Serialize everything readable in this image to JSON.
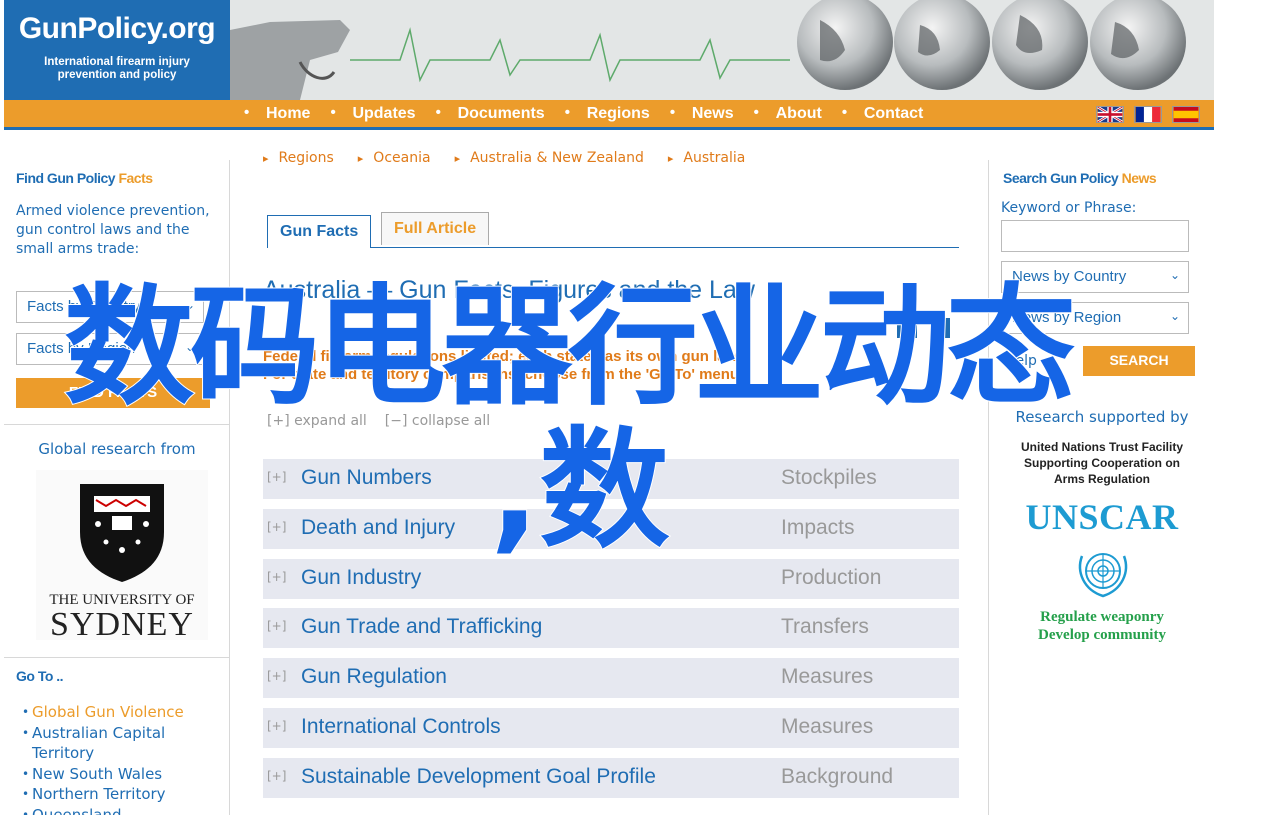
{
  "header": {
    "logo_title": "GunPolicy.org",
    "logo_subtitle_1": "International firearm injury",
    "logo_subtitle_2": "prevention and policy"
  },
  "nav": {
    "items": [
      "Home",
      "Updates",
      "Documents",
      "Regions",
      "News",
      "About",
      "Contact"
    ],
    "flags": [
      "uk-flag-icon",
      "france-flag-icon",
      "spain-flag-icon"
    ]
  },
  "left": {
    "find_title_main": "Find Gun Policy ",
    "find_title_accent": "Facts",
    "find_desc": "Armed violence prevention, gun control laws and the small arms trade:",
    "select1": "Facts by Country",
    "select2": "Facts by Region",
    "find_button": "FIND FACTS",
    "uni_text": "Global research from",
    "uni_name_1": "THE UNIVERSITY OF",
    "uni_name_2": "SYDNEY",
    "goto_title": "Go To ..",
    "goto_items": [
      "Global Gun Violence",
      "Australian Capital Territory",
      "New South Wales",
      "Northern Territory",
      "Queensland"
    ]
  },
  "main": {
    "breadcrumbs": [
      "Regions",
      "Oceania",
      "Australia & New Zealand",
      "Australia"
    ],
    "tab_active": "Gun Facts",
    "tab_other": "Full Article",
    "title": "Australia — Gun Facts, Figures and the Law",
    "intro_1": "Federal firearm regulations limited; each state has its own gun law.",
    "intro_2": "For state and territory comparisons, choose from the 'Go To' menu.",
    "expand_all": "expand all",
    "collapse_all": "collapse all",
    "rows": [
      {
        "label": "Gun Numbers",
        "category": "Stockpiles"
      },
      {
        "label": "Death and Injury",
        "category": "Impacts"
      },
      {
        "label": "Gun Industry",
        "category": "Production"
      },
      {
        "label": "Gun Trade and Trafficking",
        "category": "Transfers"
      },
      {
        "label": "Gun Regulation",
        "category": "Measures"
      },
      {
        "label": "International Controls",
        "category": "Measures"
      },
      {
        "label": "Sustainable Development Goal Profile",
        "category": "Background"
      }
    ]
  },
  "right": {
    "search_title_main": "Search Gun Policy ",
    "search_title_accent": "News",
    "keyword_label": "Keyword or Phrase:",
    "select1": "News by Country",
    "select2": "News by Region",
    "help": "Help",
    "search_button": "SEARCH",
    "research_text": "Research supported by",
    "untf_1": "United Nations Trust Facility",
    "untf_2": "Supporting Cooperation on",
    "untf_3": "Arms Regulation",
    "unscar": "UNSCAR",
    "unscar_tag_1": "Regulate weaponry",
    "unscar_tag_2": "Develop community"
  },
  "overlay": {
    "line1": "数码电器行业动态",
    "line2": ",数"
  },
  "colors": {
    "brand_blue": "#1f6db3",
    "accent_orange": "#ec9c2b",
    "row_bg": "#e6e8f0",
    "overlay_blue": "#1565e6"
  }
}
